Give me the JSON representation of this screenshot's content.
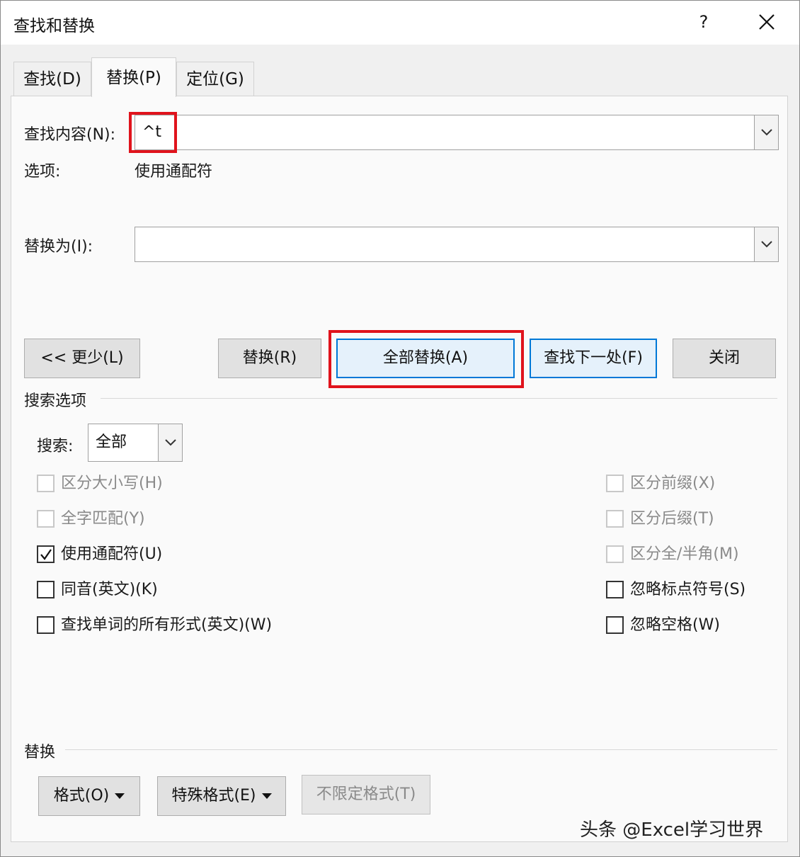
{
  "window": {
    "title": "查找和替换",
    "help_label": "?"
  },
  "tabs": [
    {
      "label": "查找(D)",
      "active": false
    },
    {
      "label": "替换(P)",
      "active": true
    },
    {
      "label": "定位(G)",
      "active": false
    }
  ],
  "find": {
    "label": "查找内容(N):",
    "value": "^t",
    "options_label": "选项:",
    "options_value": "使用通配符"
  },
  "replace": {
    "label": "替换为(I):",
    "value": ""
  },
  "buttons": {
    "less": "<< 更少(L)",
    "replace": "替换(R)",
    "replace_all": "全部替换(A)",
    "find_next": "查找下一处(F)",
    "close": "关闭"
  },
  "search_options": {
    "heading": "搜索选项",
    "search_label": "搜索:",
    "search_value": "全部",
    "left": [
      {
        "label": "区分大小写(H)",
        "checked": false,
        "disabled": true
      },
      {
        "label": "全字匹配(Y)",
        "checked": false,
        "disabled": true
      },
      {
        "label": "使用通配符(U)",
        "checked": true,
        "disabled": false
      },
      {
        "label": "同音(英文)(K)",
        "checked": false,
        "disabled": false
      },
      {
        "label": "查找单词的所有形式(英文)(W)",
        "checked": false,
        "disabled": false
      }
    ],
    "right": [
      {
        "label": "区分前缀(X)",
        "checked": false,
        "disabled": true
      },
      {
        "label": "区分后缀(T)",
        "checked": false,
        "disabled": true
      },
      {
        "label": "区分全/半角(M)",
        "checked": false,
        "disabled": true
      },
      {
        "label": "忽略标点符号(S)",
        "checked": false,
        "disabled": false
      },
      {
        "label": "忽略空格(W)",
        "checked": false,
        "disabled": false
      }
    ]
  },
  "replace_section": {
    "heading": "替换",
    "format_label": "格式(O)",
    "special_label": "特殊格式(E)",
    "no_format_label": "不限定格式(T)"
  },
  "watermark": "头条 @Excel学习世界",
  "colors": {
    "highlight_red": "#e0131c",
    "primary_blue": "#0078d7"
  }
}
